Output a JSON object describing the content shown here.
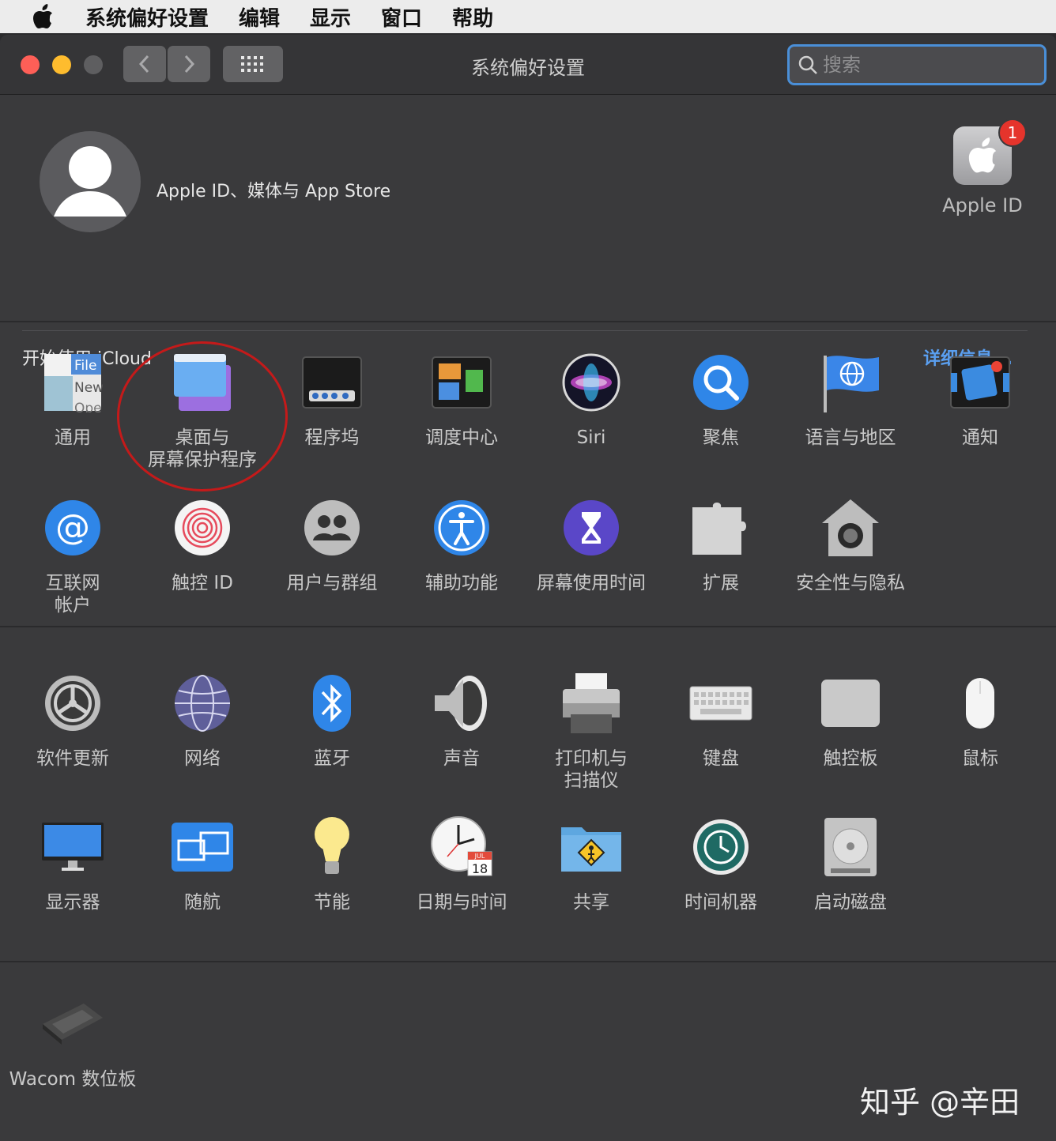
{
  "menubar": {
    "items": [
      "系统偏好设置",
      "编辑",
      "显示",
      "窗口",
      "帮助"
    ]
  },
  "window": {
    "title": "系统偏好设置",
    "search_placeholder": "搜索"
  },
  "account": {
    "label": "Apple ID、媒体与 App Store",
    "apple_id_label": "Apple ID",
    "badge_count": "1",
    "icloud_label": "开始使用 iCloud",
    "icloud_more": "详细信息..."
  },
  "panes": {
    "general": "通用",
    "desktop": "桌面与\n屏幕保护程序",
    "dock": "程序坞",
    "mission_control": "调度中心",
    "siri": "Siri",
    "spotlight": "聚焦",
    "language": "语言与地区",
    "notifications": "通知",
    "internet_accounts": "互联网\n帐户",
    "touch_id": "触控 ID",
    "users_groups": "用户与群组",
    "accessibility": "辅助功能",
    "screen_time": "屏幕使用时间",
    "extensions": "扩展",
    "security": "安全性与隐私",
    "software_update": "软件更新",
    "network": "网络",
    "bluetooth": "蓝牙",
    "sound": "声音",
    "printers": "打印机与\n扫描仪",
    "keyboard": "键盘",
    "trackpad": "触控板",
    "mouse": "鼠标",
    "displays": "显示器",
    "sidecar": "随航",
    "energy": "节能",
    "date_time": "日期与时间",
    "sharing": "共享",
    "time_machine": "时间机器",
    "startup_disk": "启动磁盘",
    "wacom": "Wacom 数位板"
  },
  "icon_text": {
    "general_file": "File",
    "general_new": "New",
    "general_open": "Ope",
    "calendar_month": "JUL",
    "calendar_day": "18"
  },
  "watermark": "知乎 @辛田"
}
